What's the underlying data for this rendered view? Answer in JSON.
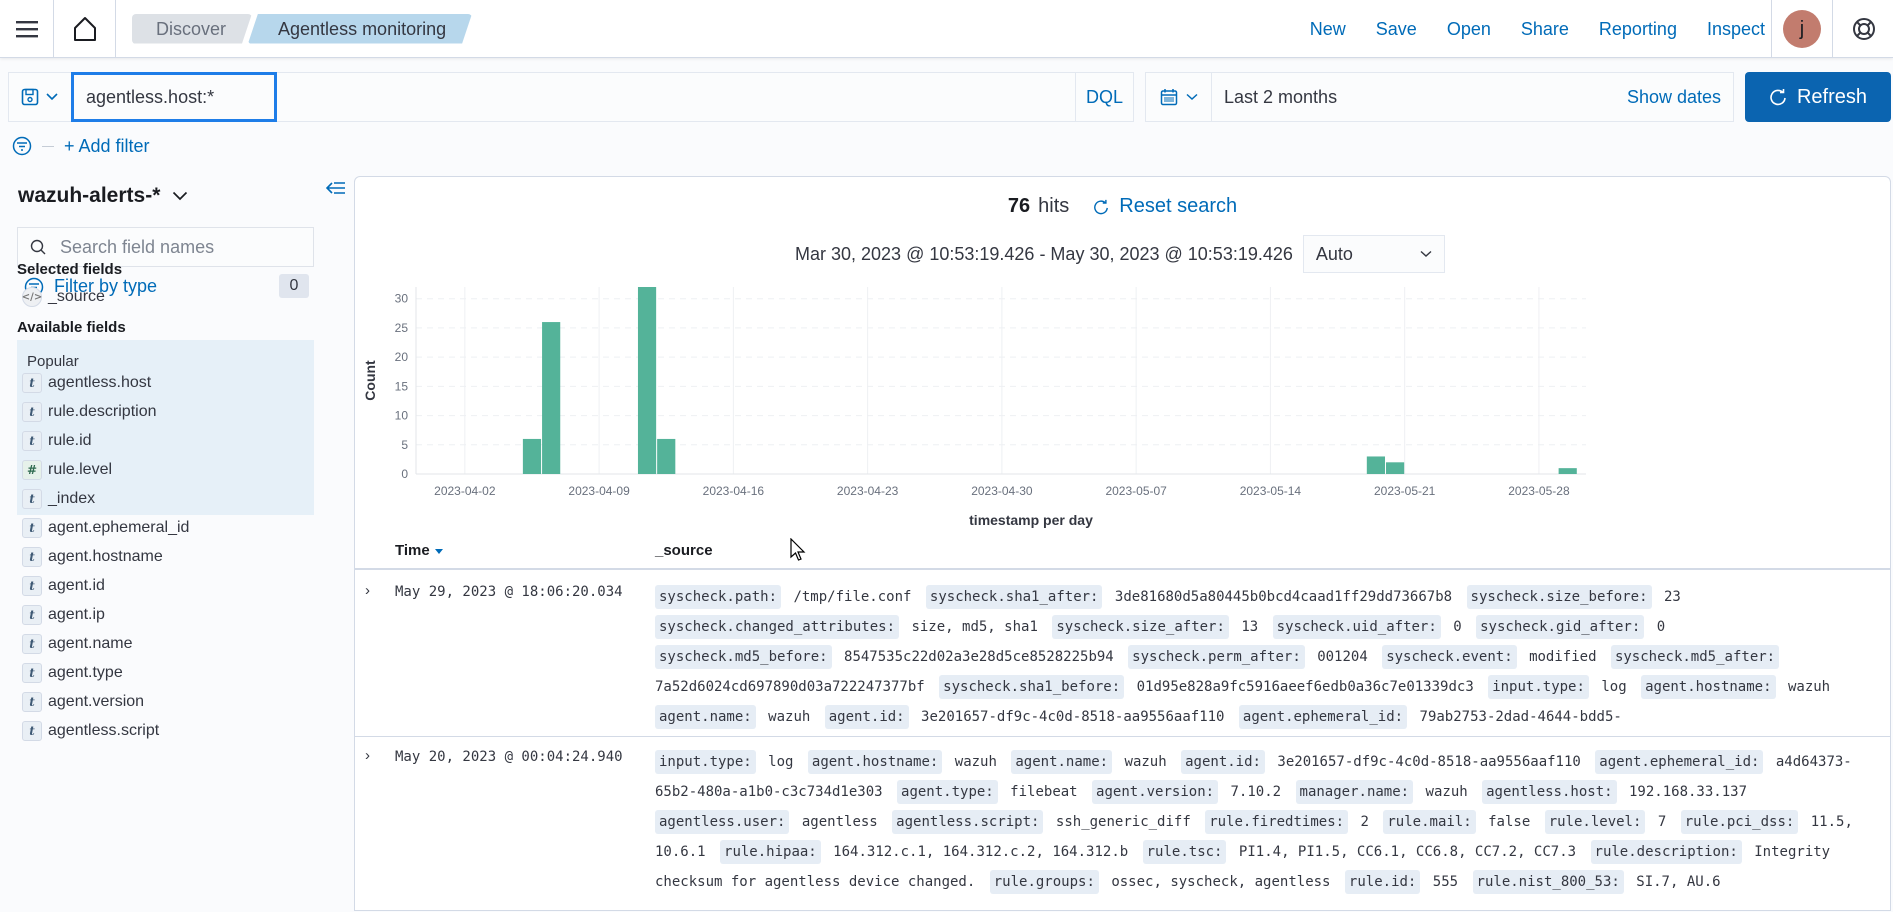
{
  "header": {
    "breadcrumbs": [
      "Discover",
      "Agentless monitoring"
    ],
    "links": [
      "New",
      "Save",
      "Open",
      "Share",
      "Reporting",
      "Inspect"
    ],
    "avatar_initial": "j"
  },
  "query": {
    "value": "agentless.host:*",
    "language": "DQL"
  },
  "datepicker": {
    "range_label": "Last 2 months",
    "show_dates": "Show dates",
    "refresh": "Refresh"
  },
  "filters": {
    "add_filter": "+ Add filter"
  },
  "sidebar": {
    "index_pattern": "wazuh-alerts-*",
    "search_placeholder": "Search field names",
    "filter_by_type": "Filter by type",
    "filter_count": "0",
    "selected_title": "Selected fields",
    "selected_fields": [
      {
        "name": "_source",
        "type": "source"
      }
    ],
    "available_title": "Available fields",
    "popular_title": "Popular",
    "popular_fields": [
      {
        "name": "agentless.host",
        "type": "t"
      },
      {
        "name": "rule.description",
        "type": "t"
      },
      {
        "name": "rule.id",
        "type": "t"
      },
      {
        "name": "rule.level",
        "type": "#"
      }
    ],
    "other_fields": [
      {
        "name": "_index",
        "type": "t"
      },
      {
        "name": "agent.ephemeral_id",
        "type": "t"
      },
      {
        "name": "agent.hostname",
        "type": "t"
      },
      {
        "name": "agent.id",
        "type": "t"
      },
      {
        "name": "agent.ip",
        "type": "t"
      },
      {
        "name": "agent.name",
        "type": "t"
      },
      {
        "name": "agent.type",
        "type": "t"
      },
      {
        "name": "agent.version",
        "type": "t"
      },
      {
        "name": "agentless.script",
        "type": "t"
      }
    ]
  },
  "results": {
    "hits_count": "76",
    "hits_label": "hits",
    "reset_search": "Reset search",
    "time_range": "Mar 30, 2023 @ 10:53:19.426 - May 30, 2023 @ 10:53:19.426",
    "interval": "Auto",
    "columns": {
      "time": "Time",
      "source": "_source"
    },
    "rows": [
      {
        "time": "May 29, 2023 @ 18:06:20.034",
        "fields": [
          [
            "syscheck.path:",
            "/tmp/file.conf"
          ],
          [
            "syscheck.sha1_after:",
            "3de81680d5a80445b0bcd4caad1ff29dd73667b8"
          ],
          [
            "syscheck.size_before:",
            "23"
          ],
          [
            "syscheck.changed_attributes:",
            "size, md5, sha1"
          ],
          [
            "syscheck.size_after:",
            "13"
          ],
          [
            "syscheck.uid_after:",
            "0"
          ],
          [
            "syscheck.gid_after:",
            "0"
          ],
          [
            "syscheck.md5_before:",
            "8547535c22d02a3e28d5ce8528225b94"
          ],
          [
            "syscheck.perm_after:",
            "001204"
          ],
          [
            "syscheck.event:",
            "modified"
          ],
          [
            "syscheck.md5_after:",
            "7a52d6024cd697890d03a722247377bf"
          ],
          [
            "syscheck.sha1_before:",
            "01d95e828a9fc5916aeef6edb0a36c7e01339dc3"
          ],
          [
            "input.type:",
            "log"
          ],
          [
            "agent.hostname:",
            "wazuh"
          ],
          [
            "agent.name:",
            "wazuh"
          ],
          [
            "agent.id:",
            "3e201657-df9c-4c0d-8518-aa9556aaf110"
          ],
          [
            "agent.ephemeral_id:",
            "79ab2753-2dad-4644-bdd5-"
          ]
        ]
      },
      {
        "time": "May 20, 2023 @ 00:04:24.940",
        "fields": [
          [
            "input.type:",
            "log"
          ],
          [
            "agent.hostname:",
            "wazuh"
          ],
          [
            "agent.name:",
            "wazuh"
          ],
          [
            "agent.id:",
            "3e201657-df9c-4c0d-8518-aa9556aaf110"
          ],
          [
            "agent.ephemeral_id:",
            "a4d64373-65b2-480a-a1b0-c3c734d1e303"
          ],
          [
            "agent.type:",
            "filebeat"
          ],
          [
            "agent.version:",
            "7.10.2"
          ],
          [
            "manager.name:",
            "wazuh"
          ],
          [
            "agentless.host:",
            "192.168.33.137"
          ],
          [
            "agentless.user:",
            "agentless"
          ],
          [
            "agentless.script:",
            "ssh_generic_diff"
          ],
          [
            "rule.firedtimes:",
            "2"
          ],
          [
            "rule.mail:",
            "false"
          ],
          [
            "rule.level:",
            "7"
          ],
          [
            "rule.pci_dss:",
            "11.5, 10.6.1"
          ],
          [
            "rule.hipaa:",
            "164.312.c.1, 164.312.c.2, 164.312.b"
          ],
          [
            "rule.tsc:",
            "PI1.4, PI1.5, CC6.1, CC6.8, CC7.2, CC7.3"
          ],
          [
            "rule.description:",
            "Integrity checksum for agentless device changed."
          ],
          [
            "rule.groups:",
            "ossec, syscheck, agentless"
          ],
          [
            "rule.id:",
            "555"
          ],
          [
            "rule.nist_800_53:",
            "SI.7, AU.6"
          ]
        ]
      }
    ]
  },
  "chart_data": {
    "type": "bar",
    "title": "",
    "xlabel": "timestamp per day",
    "ylabel": "Count",
    "ylim": [
      0,
      32
    ],
    "yticks": [
      0,
      5,
      10,
      15,
      20,
      25,
      30
    ],
    "xrange": [
      "2023-03-30",
      "2023-05-30"
    ],
    "xticks": [
      "2023-04-02",
      "2023-04-09",
      "2023-04-16",
      "2023-04-23",
      "2023-04-30",
      "2023-05-07",
      "2023-05-14",
      "2023-05-21",
      "2023-05-28"
    ],
    "grid": true,
    "bar_color": "#54b399",
    "points": [
      {
        "date": "2023-04-05",
        "count": 6
      },
      {
        "date": "2023-04-06",
        "count": 26
      },
      {
        "date": "2023-04-11",
        "count": 32
      },
      {
        "date": "2023-04-12",
        "count": 6
      },
      {
        "date": "2023-05-19",
        "count": 3
      },
      {
        "date": "2023-05-20",
        "count": 2
      },
      {
        "date": "2023-05-29",
        "count": 1
      }
    ]
  }
}
